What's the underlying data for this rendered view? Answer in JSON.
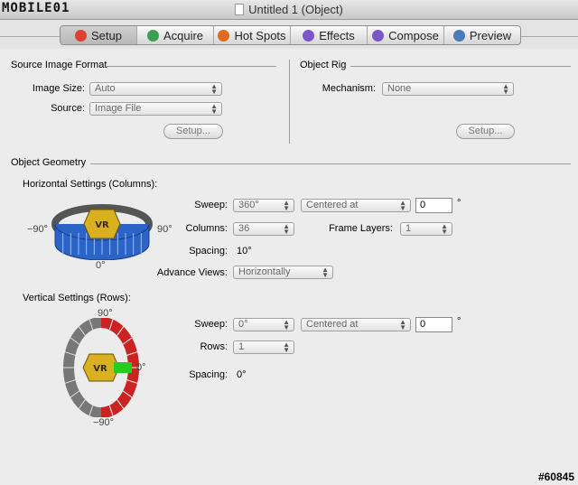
{
  "window": {
    "title": "Untitled 1 (Object)",
    "watermark_logo": "MOBILE01",
    "watermark_id": "#60845"
  },
  "tabs": [
    {
      "label": "Setup",
      "icon": "pie-chart-icon",
      "color": "#e04030",
      "selected": true
    },
    {
      "label": "Acquire",
      "icon": "acquire-arrow-icon",
      "color": "#3aa050"
    },
    {
      "label": "Hot Spots",
      "icon": "hot-spots-icon",
      "color": "#e06a20"
    },
    {
      "label": "Effects",
      "icon": "effects-lightning-icon",
      "color": "#7a56c8"
    },
    {
      "label": "Compose",
      "icon": "compose-icon",
      "color": "#7a56c8"
    },
    {
      "label": "Preview",
      "icon": "preview-eye-icon",
      "color": "#4a7ab8"
    }
  ],
  "source_image_format": {
    "title": "Source Image Format",
    "image_size_label": "Image Size:",
    "image_size_value": "Auto",
    "source_label": "Source:",
    "source_value": "Image File",
    "setup_button": "Setup..."
  },
  "object_rig": {
    "title": "Object Rig",
    "mechanism_label": "Mechanism:",
    "mechanism_value": "None",
    "setup_button": "Setup..."
  },
  "object_geometry": {
    "title": "Object Geometry",
    "horizontal": {
      "title": "Horizontal Settings (Columns):",
      "sweep_label": "Sweep:",
      "sweep_value": "360°",
      "alignment_value": "Centered at",
      "angle_value": "0",
      "degree_symbol": "°",
      "columns_label": "Columns:",
      "columns_value": "36",
      "frame_layers_label": "Frame Layers:",
      "frame_layers_value": "1",
      "spacing_label": "Spacing:",
      "spacing_value": "10°",
      "advance_label": "Advance Views:",
      "advance_value": "Horizontally",
      "dial_left": "−90°",
      "dial_right": "90°",
      "dial_bottom": "0°",
      "center_badge": "VR"
    },
    "vertical": {
      "title": "Vertical Settings (Rows):",
      "sweep_label": "Sweep:",
      "sweep_value": "0°",
      "alignment_value": "Centered at",
      "angle_value": "0",
      "degree_symbol": "°",
      "rows_label": "Rows:",
      "rows_value": "1",
      "spacing_label": "Spacing:",
      "spacing_value": "0°",
      "dial_top": "90°",
      "dial_right": "0°",
      "dial_bottom": "−90°",
      "center_badge": "VR"
    }
  },
  "colors": {
    "h_ring": "#2c63c6",
    "v_ring": "#cc2222",
    "v_ring_inactive": "#777777",
    "v_indicator": "#22cc22",
    "badge": "#d8b020"
  }
}
